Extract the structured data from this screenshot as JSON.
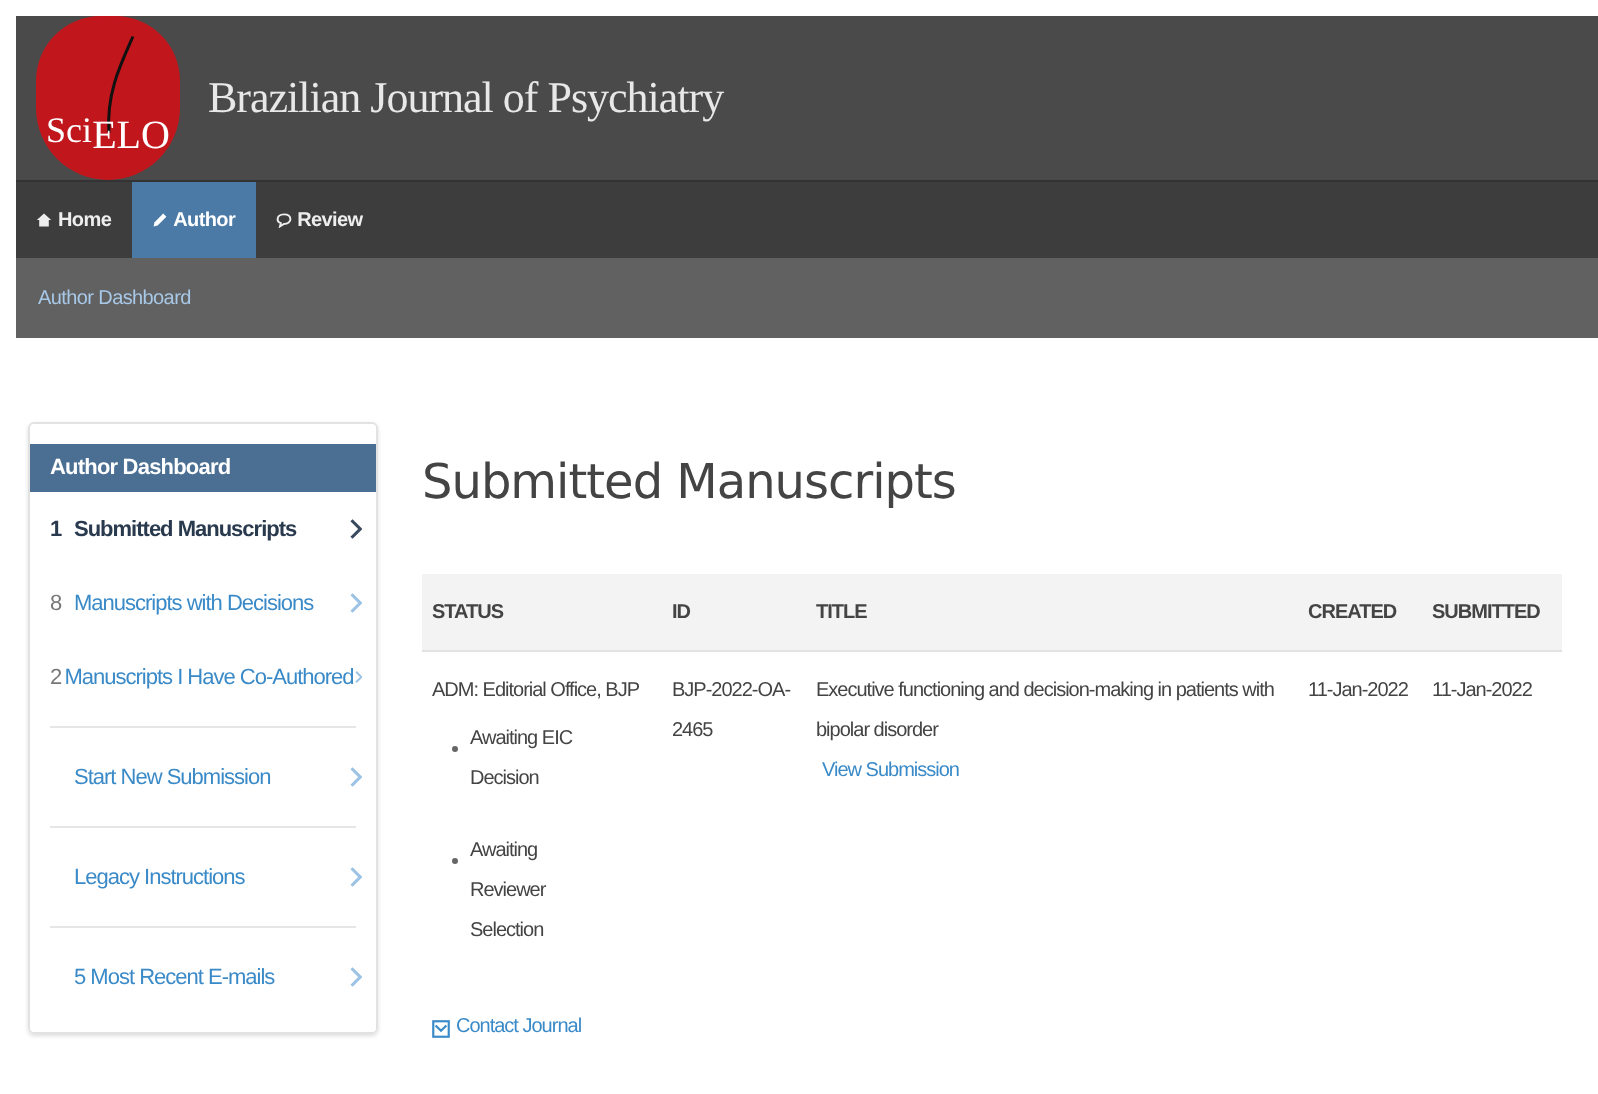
{
  "header": {
    "logo": {
      "left": "Sci",
      "right": "ELO"
    },
    "title": "Brazilian Journal of Psychiatry"
  },
  "nav": [
    {
      "label": "Home",
      "kind": "home",
      "selected": false
    },
    {
      "label": "Author",
      "kind": "author",
      "selected": true
    },
    {
      "label": "Review",
      "kind": "review",
      "selected": false
    }
  ],
  "breadcrumb": "Author Dashboard",
  "sidebar": {
    "title": "Author Dashboard",
    "items": [
      {
        "count": "1",
        "label": "Submitted Manuscripts",
        "selected": true
      },
      {
        "count": "8",
        "label": "Manuscripts with Decisions",
        "selected": false
      },
      {
        "count": "2",
        "label": "Manuscripts I Have Co-Authored",
        "selected": false
      },
      {
        "label": "Start New Submission",
        "selected": false
      },
      {
        "label": "Legacy Instructions",
        "selected": false
      },
      {
        "label": "5 Most Recent E-mails",
        "selected": false
      }
    ]
  },
  "heading": "Submitted Manuscripts",
  "table": {
    "columns": [
      "STATUS",
      "ID",
      "TITLE",
      "CREATED",
      "SUBMITTED"
    ],
    "rows": [
      {
        "status": "ADM: Editorial Office, BJP",
        "status_items": [
          "Awaiting EIC Decision",
          "Awaiting Reviewer Selection"
        ],
        "id": "BJP-2022-OA-2465",
        "title": "Executive functioning and decision-making in patients with bipolar disorder",
        "link": "View Submission",
        "created": "11-Jan-2022",
        "submitted": "11-Jan-2022",
        "contact": "Contact Journal"
      }
    ]
  }
}
